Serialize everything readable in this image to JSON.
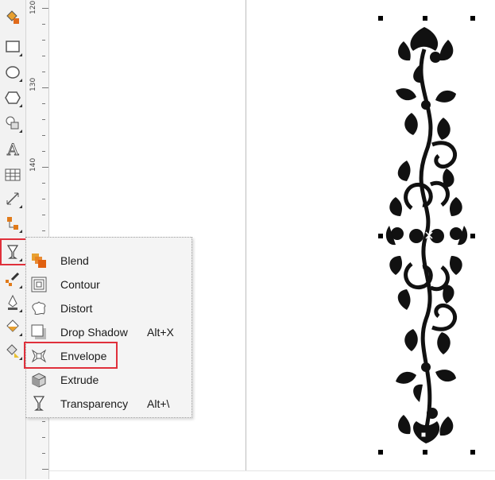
{
  "ruler": {
    "labels": [
      "120",
      "130",
      "140"
    ]
  },
  "flyout": {
    "items": [
      {
        "label": "Blend",
        "shortcut": "",
        "icon": "blend-icon"
      },
      {
        "label": "Contour",
        "shortcut": "",
        "icon": "contour-icon"
      },
      {
        "label": "Distort",
        "shortcut": "",
        "icon": "distort-icon"
      },
      {
        "label": "Drop Shadow",
        "shortcut": "Alt+X",
        "icon": "drop-shadow-icon"
      },
      {
        "label": "Envelope",
        "shortcut": "",
        "icon": "envelope-icon"
      },
      {
        "label": "Extrude",
        "shortcut": "",
        "icon": "extrude-icon"
      },
      {
        "label": "Transparency",
        "shortcut": "Alt+\\",
        "icon": "transparency-icon"
      }
    ]
  },
  "toolbox": {
    "tools": [
      "smart-fill-icon",
      "rectangle-icon",
      "ellipse-icon",
      "polygon-icon",
      "basic-shapes-icon",
      "text-icon",
      "table-icon",
      "dimension-icon",
      "connector-icon",
      "interactive-effects-icon",
      "eyedropper-icon",
      "outline-pen-icon",
      "fill-icon",
      "interactive-fill-icon"
    ]
  },
  "colors": {
    "highlight": "#e0303b",
    "ornament": "#111111"
  }
}
